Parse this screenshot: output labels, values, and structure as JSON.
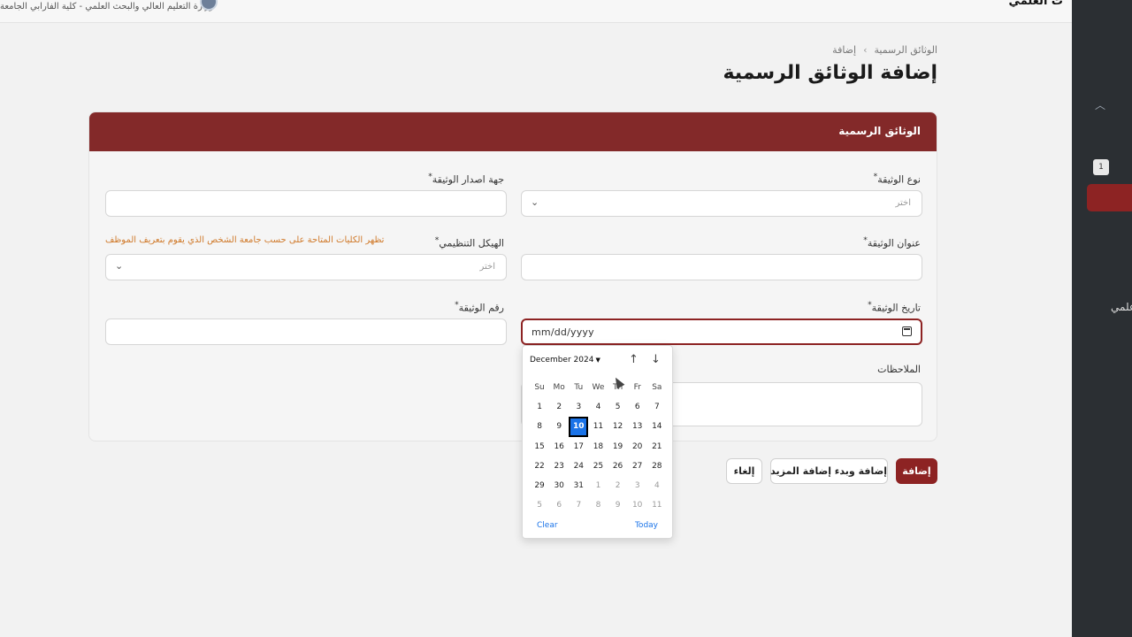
{
  "topbar": {
    "org_text": "وزارة التعليم العالي والبحث العلمي - كلية الفارابي الجامعة",
    "right_title": "ث العلمي"
  },
  "sidebar": {
    "badge_count": "1",
    "cut_label": "علمي"
  },
  "breadcrumb": {
    "parent": "الوثائق الرسمية",
    "current": "إضافة"
  },
  "page_title": "إضافة الوثائق الرسمية",
  "card": {
    "header": "الوثائق الرسمية",
    "fields": {
      "doc_type": {
        "label": "نوع الوثيقة",
        "placeholder": "اختر"
      },
      "issuer": {
        "label": "جهة اصدار الوثيقة",
        "value": ""
      },
      "doc_title": {
        "label": "عنوان الوثيقة",
        "value": ""
      },
      "org_structure": {
        "label": "الهيكل التنظيمي",
        "placeholder": "اختر",
        "hint": "تظهر الكليات المتاحة على حسب جامعة الشخص الذي يقوم بتعريف الموظف"
      },
      "doc_date": {
        "label": "تاريخ الوثيقة",
        "value": "mm/dd/yyyy"
      },
      "doc_number": {
        "label": "رقم الوثيقة",
        "value": ""
      },
      "notes": {
        "label": "الملاحظات",
        "value": ""
      }
    },
    "required_mark": "*"
  },
  "buttons": {
    "add": "إضافة",
    "add_and_more": "إضافة وبدء إضافة المزيد",
    "cancel": "إلغاء"
  },
  "datepicker": {
    "month_label": "December 2024",
    "weekdays": [
      "Su",
      "Mo",
      "Tu",
      "We",
      "Th",
      "Fr",
      "Sa"
    ],
    "weeks": [
      [
        {
          "d": "1"
        },
        {
          "d": "2"
        },
        {
          "d": "3"
        },
        {
          "d": "4"
        },
        {
          "d": "5"
        },
        {
          "d": "6"
        },
        {
          "d": "7"
        }
      ],
      [
        {
          "d": "8"
        },
        {
          "d": "9"
        },
        {
          "d": "10",
          "selected": true
        },
        {
          "d": "11"
        },
        {
          "d": "12"
        },
        {
          "d": "13"
        },
        {
          "d": "14"
        }
      ],
      [
        {
          "d": "15"
        },
        {
          "d": "16"
        },
        {
          "d": "17"
        },
        {
          "d": "18"
        },
        {
          "d": "19"
        },
        {
          "d": "20"
        },
        {
          "d": "21"
        }
      ],
      [
        {
          "d": "22"
        },
        {
          "d": "23"
        },
        {
          "d": "24"
        },
        {
          "d": "25"
        },
        {
          "d": "26"
        },
        {
          "d": "27"
        },
        {
          "d": "28"
        }
      ],
      [
        {
          "d": "29"
        },
        {
          "d": "30"
        },
        {
          "d": "31"
        },
        {
          "d": "1",
          "muted": true
        },
        {
          "d": "2",
          "muted": true
        },
        {
          "d": "3",
          "muted": true
        },
        {
          "d": "4",
          "muted": true
        }
      ],
      [
        {
          "d": "5",
          "muted": true
        },
        {
          "d": "6",
          "muted": true
        },
        {
          "d": "7",
          "muted": true
        },
        {
          "d": "8",
          "muted": true
        },
        {
          "d": "9",
          "muted": true
        },
        {
          "d": "10",
          "muted": true
        },
        {
          "d": "11",
          "muted": true
        }
      ]
    ],
    "clear_label": "Clear",
    "today_label": "Today"
  },
  "colors": {
    "brand": "#832929",
    "primary_button": "#8d2323",
    "hint": "#d07a2b",
    "selected_day": "#1a73e8",
    "sidebar_bg": "#2b2f33"
  },
  "icons": {
    "dropdown": "chevron-down-icon",
    "calendar": "calendar-icon",
    "prev_month": "arrow-up-icon",
    "next_month": "arrow-down-icon",
    "sidebar_toggle": "chevron-up-icon"
  }
}
